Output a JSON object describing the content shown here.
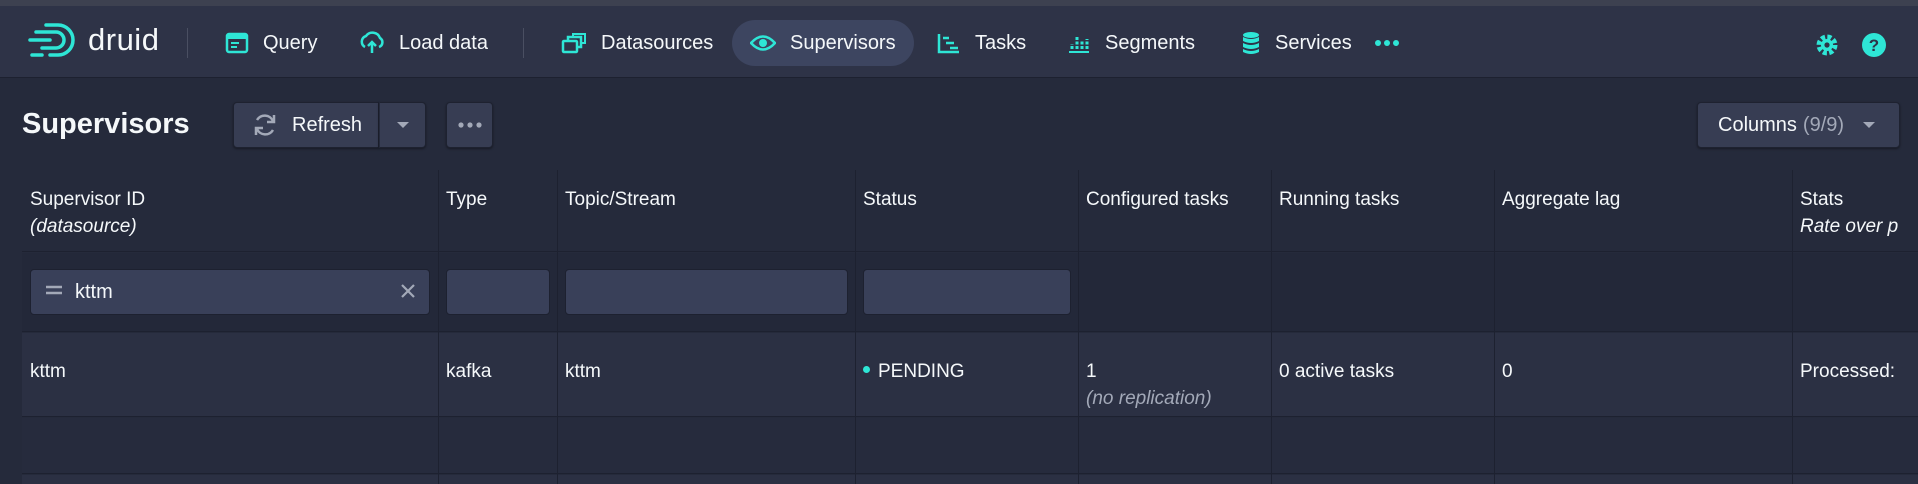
{
  "app": {
    "logo_text": "druid"
  },
  "nav": {
    "query": "Query",
    "load_data": "Load data",
    "datasources": "Datasources",
    "supervisors": "Supervisors",
    "tasks": "Tasks",
    "segments": "Segments",
    "services": "Services"
  },
  "page": {
    "title": "Supervisors",
    "refresh_label": "Refresh",
    "columns_label": "Columns",
    "columns_count": "(9/9)"
  },
  "table": {
    "headers": {
      "supervisor_id": "Supervisor ID",
      "supervisor_id_sub": "(datasource)",
      "type": "Type",
      "topic": "Topic/Stream",
      "status": "Status",
      "configured_tasks": "Configured tasks",
      "running_tasks": "Running tasks",
      "aggregate_lag": "Aggregate lag",
      "stats": "Stats",
      "stats_sub": "Rate over p"
    },
    "filters": {
      "supervisor_id": "kttm",
      "type": "",
      "topic": "",
      "status": ""
    },
    "rows": [
      {
        "supervisor_id": "kttm",
        "type": "kafka",
        "topic": "kttm",
        "status": "PENDING",
        "configured_tasks": "1",
        "configured_tasks_note": "(no replication)",
        "running_tasks": "0 active tasks",
        "aggregate_lag": "0",
        "stats": "Processed:"
      }
    ]
  },
  "colors": {
    "accent": "#2ee6d6",
    "navbar": "#2e3347",
    "background": "#252a3b"
  }
}
